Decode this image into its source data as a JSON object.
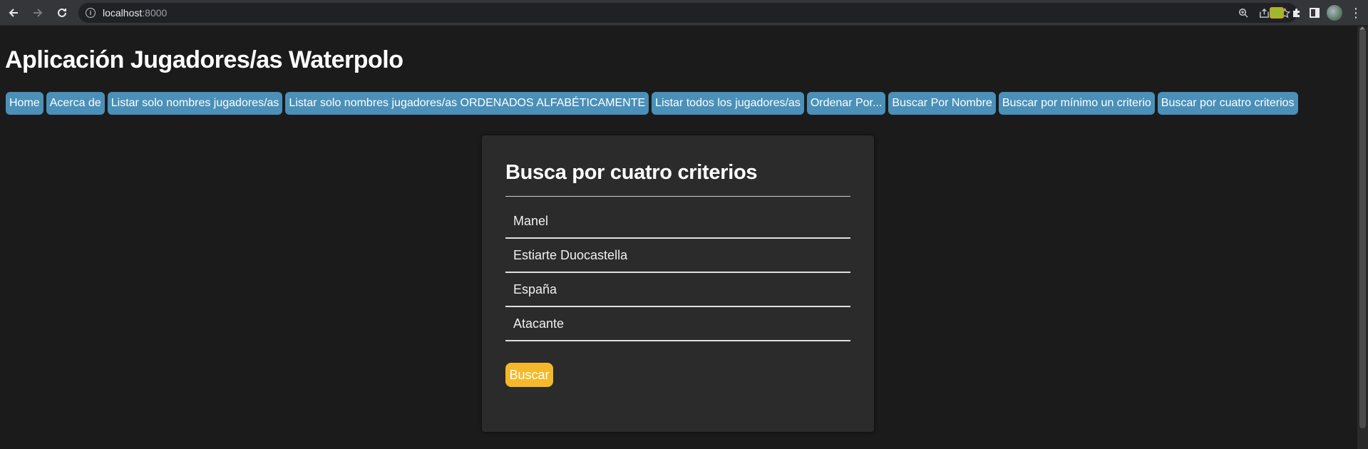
{
  "browser": {
    "url_host": "localhost",
    "url_port": ":8000",
    "back_icon": "arrow-left-icon",
    "forward_icon": "arrow-right-icon",
    "reload_icon": "reload-icon"
  },
  "app": {
    "title": "Aplicación Jugadores/as Waterpolo"
  },
  "menu": {
    "items": [
      {
        "label": "Home"
      },
      {
        "label": "Acerca de"
      },
      {
        "label": "Listar solo nombres jugadores/as"
      },
      {
        "label": "Listar solo nombres jugadores/as ORDENADOS ALFABÉTICAMENTE"
      },
      {
        "label": "Listar todos los jugadores/as"
      },
      {
        "label": "Ordenar Por..."
      },
      {
        "label": "Buscar Por Nombre"
      },
      {
        "label": "Buscar por mínimo un criterio"
      },
      {
        "label": "Buscar por cuatro criterios"
      }
    ]
  },
  "form": {
    "title": "Busca por cuatro criterios",
    "fields": [
      {
        "value": "Manel"
      },
      {
        "value": "Estiarte Duocastella"
      },
      {
        "value": "España"
      },
      {
        "value": "Atacante"
      }
    ],
    "submit_label": "Buscar"
  },
  "colors": {
    "menu_button": "#4a90b8",
    "submit_button": "#f5b82a",
    "background": "#1b1b1b",
    "card": "#2b2b2b"
  }
}
